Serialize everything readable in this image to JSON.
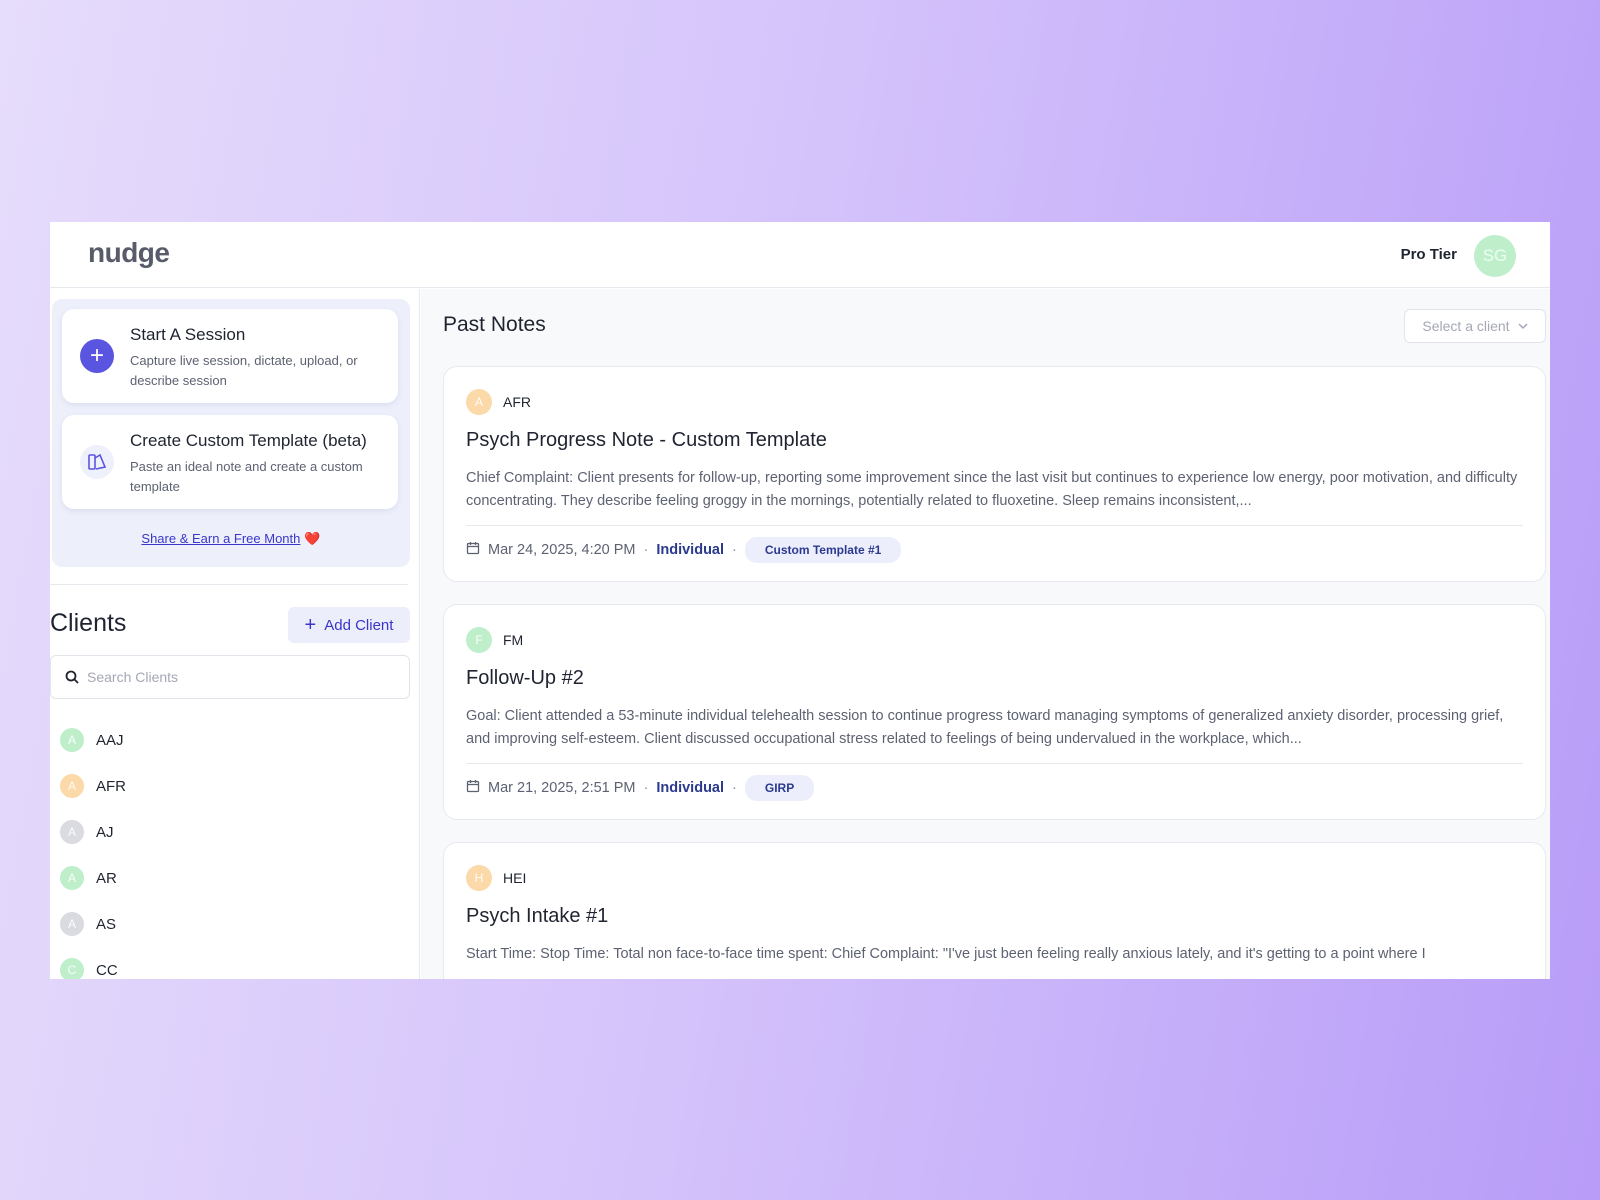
{
  "app": {
    "logo": "nudge",
    "tier": "Pro Tier",
    "avatar_initials": "SG",
    "avatar_color": "#bfeecb"
  },
  "sidebar": {
    "actions": [
      {
        "title": "Start A Session",
        "description": "Capture live session, dictate, upload, or describe session",
        "icon": "plus-icon"
      },
      {
        "title": "Create Custom Template (beta)",
        "description": "Paste an ideal note and create a custom template",
        "icon": "template-icon"
      }
    ],
    "share_link": "Share & Earn a Free Month",
    "share_emoji": "❤️"
  },
  "clients": {
    "title": "Clients",
    "add_label": "Add Client",
    "search_placeholder": "Search Clients",
    "items": [
      {
        "initial": "A",
        "name": "AAJ",
        "color": "#bfeecb"
      },
      {
        "initial": "A",
        "name": "AFR",
        "color": "#fcd9a8"
      },
      {
        "initial": "A",
        "name": "AJ",
        "color": "#d9dbe0"
      },
      {
        "initial": "A",
        "name": "AR",
        "color": "#bfeecb"
      },
      {
        "initial": "A",
        "name": "AS",
        "color": "#d9dbe0"
      },
      {
        "initial": "C",
        "name": "CC",
        "color": "#bfeecb"
      }
    ]
  },
  "main": {
    "title": "Past Notes",
    "select_placeholder": "Select a client",
    "notes": [
      {
        "client_initial": "A",
        "client": "AFR",
        "avatar_color": "#fcd9a8",
        "title": "Psych Progress Note - Custom Template",
        "body": "Chief Complaint: Client presents for follow-up, reporting some improvement since the last visit but continues to experience low energy, poor motivation, and difficulty concentrating. They describe feeling groggy in the mornings, potentially related to fluoxetine. Sleep remains inconsistent,...",
        "date": "Mar 24, 2025, 4:20 PM",
        "type": "Individual",
        "tag": "Custom Template #1"
      },
      {
        "client_initial": "F",
        "client": "FM",
        "avatar_color": "#bfeecb",
        "title": "Follow-Up #2",
        "body": "Goal: Client attended a 53-minute individual telehealth session to continue progress toward managing symptoms of generalized anxiety disorder, processing grief, and improving self-esteem. Client discussed occupational stress related to feelings of being undervalued in the workplace, which...",
        "date": "Mar 21, 2025, 2:51 PM",
        "type": "Individual",
        "tag": "GIRP"
      },
      {
        "client_initial": "H",
        "client": "HEI",
        "avatar_color": "#fcd9a8",
        "title": "Psych Intake #1",
        "body": "Start Time: Stop Time: Total non face-to-face time spent: Chief Complaint: \"I've just been feeling really anxious lately, and it's getting to a point where I",
        "date": "",
        "type": "",
        "tag": ""
      }
    ]
  }
}
